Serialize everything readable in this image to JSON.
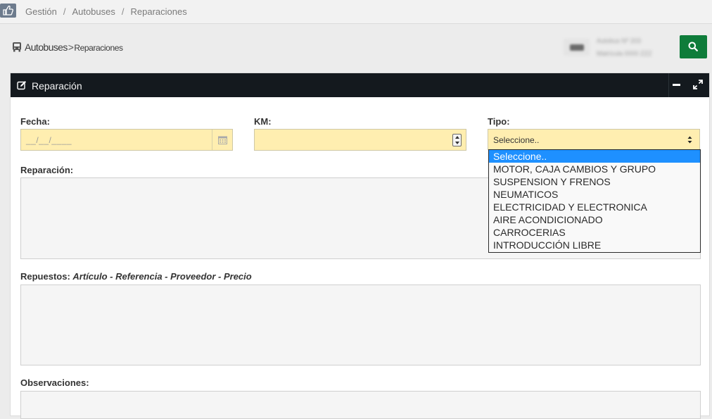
{
  "breadcrumb": [
    "Gestión",
    "Autobuses",
    "Reparaciones"
  ],
  "header": {
    "title_main": "Autobuses",
    "title_sep": ">",
    "title_sub": "Reparaciones",
    "vehicle_line1": "Autobus Nº 203",
    "vehicle_line2": "Matrícula 0000 ZZZ"
  },
  "panel": {
    "title": "Reparación"
  },
  "form": {
    "fecha_label": "Fecha:",
    "fecha_placeholder": "__/__/____",
    "km_label": "KM:",
    "tipo_label": "Tipo:",
    "tipo_value": "Seleccione..",
    "reparacion_label": "Reparación:",
    "repuestos_label": "Repuestos:",
    "repuestos_hint": "Artículo - Referencia - Proveedor - Precio",
    "observaciones_label": "Observaciones:"
  },
  "tipo_options": [
    "Seleccione..",
    "MOTOR, CAJA CAMBIOS Y GRUPO",
    "SUSPENSION Y FRENOS",
    "NEUMATICOS",
    "ELECTRICIDAD Y ELECTRONICA",
    "AIRE ACONDICIONADO",
    "CARROCERIAS",
    "INTRODUCCIÓN LIBRE"
  ],
  "colors": {
    "panel_header": "#14191e",
    "input_fill": "#ffeeb0",
    "search_button": "#0e7c3a",
    "selected_option": "#1e90ff"
  },
  "icons": [
    "thumbs-up-icon",
    "bus-icon",
    "search-icon",
    "edit-icon",
    "minimize-icon",
    "expand-icon",
    "calendar-icon",
    "select-arrows-icon"
  ]
}
